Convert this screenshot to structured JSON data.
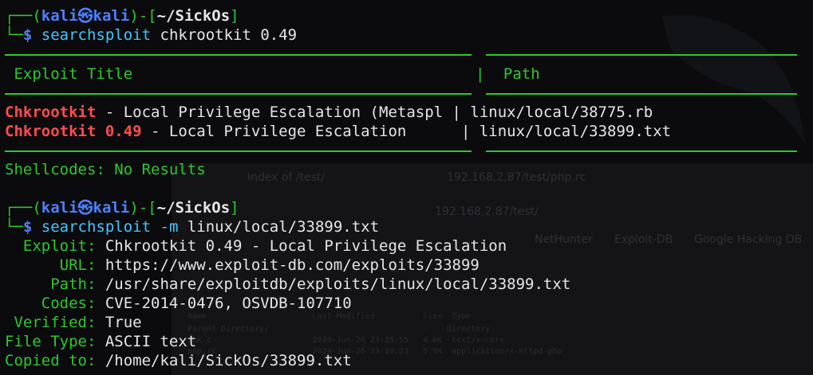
{
  "background": {
    "tab_1": "Index of /test/",
    "tab_2": "192.168.2.87/test/php.rc",
    "address": "192.168.2.87/test/",
    "bookmark_1": "NetHunter",
    "bookmark_2": "Exploit-DB",
    "bookmark_3": "Google Hacking DB",
    "listing_header": "Name                      Last Modified          Size  Type",
    "listing_row_1": "Parent Directory/                                -    Directory",
    "listing_row_2": "chk.c                     2024-Jun-26 23:35:55   4.8K  text/x-csrc",
    "listing_row_3": "php.rc                    2024-Jun-26 23:10:23   5.9K  application/x-httpd-php"
  },
  "prompt1": {
    "box_top": "┌──(",
    "user": "kali",
    "at": "㉿",
    "host": "kali",
    "mid": ")-[",
    "cwd": "~/SickOs",
    "end": "]",
    "box_bottom": "└─",
    "dollar": "$",
    "command": "searchsploit",
    "args": " chkrootkit 0.49"
  },
  "table": {
    "col1_header": " Exploit Title",
    "separator": "|",
    "col2_header": "  Path",
    "rows": [
      {
        "highlight": "Chkrootkit",
        "rest": " - Local Privilege Escalation (Metaspl",
        "sep": " | ",
        "path": "linux/local/38775.rb"
      },
      {
        "highlight": "Chkrootkit",
        "version": " 0.49",
        "rest": " - Local Privilege Escalation     ",
        "sep": " | ",
        "path": "linux/local/33899.txt"
      }
    ],
    "shellcodes": "Shellcodes: No Results"
  },
  "prompt2": {
    "box_top": "┌──(",
    "user": "kali",
    "at": "㉿",
    "host": "kali",
    "mid": ")-[",
    "cwd": "~/SickOs",
    "end": "]",
    "box_bottom": "└─",
    "dollar": "$",
    "command": "searchsploit",
    "flag": " -m",
    "args": " linux/local/33899.txt"
  },
  "details": [
    {
      "label": "  Exploit:",
      "value": " Chkrootkit 0.49 - Local Privilege Escalation"
    },
    {
      "label": "      URL:",
      "value": " https://www.exploit-db.com/exploits/33899"
    },
    {
      "label": "     Path:",
      "value": " /usr/share/exploitdb/exploits/linux/local/33899.txt"
    },
    {
      "label": "    Codes:",
      "value": " CVE-2014-0476, OSVDB-107710"
    },
    {
      "label": " Verified:",
      "value": " True"
    },
    {
      "label": "File Type:",
      "value": " ASCII text"
    },
    {
      "label": "Copied to:",
      "value": " /home/kali/SickOs/33899.txt"
    }
  ]
}
